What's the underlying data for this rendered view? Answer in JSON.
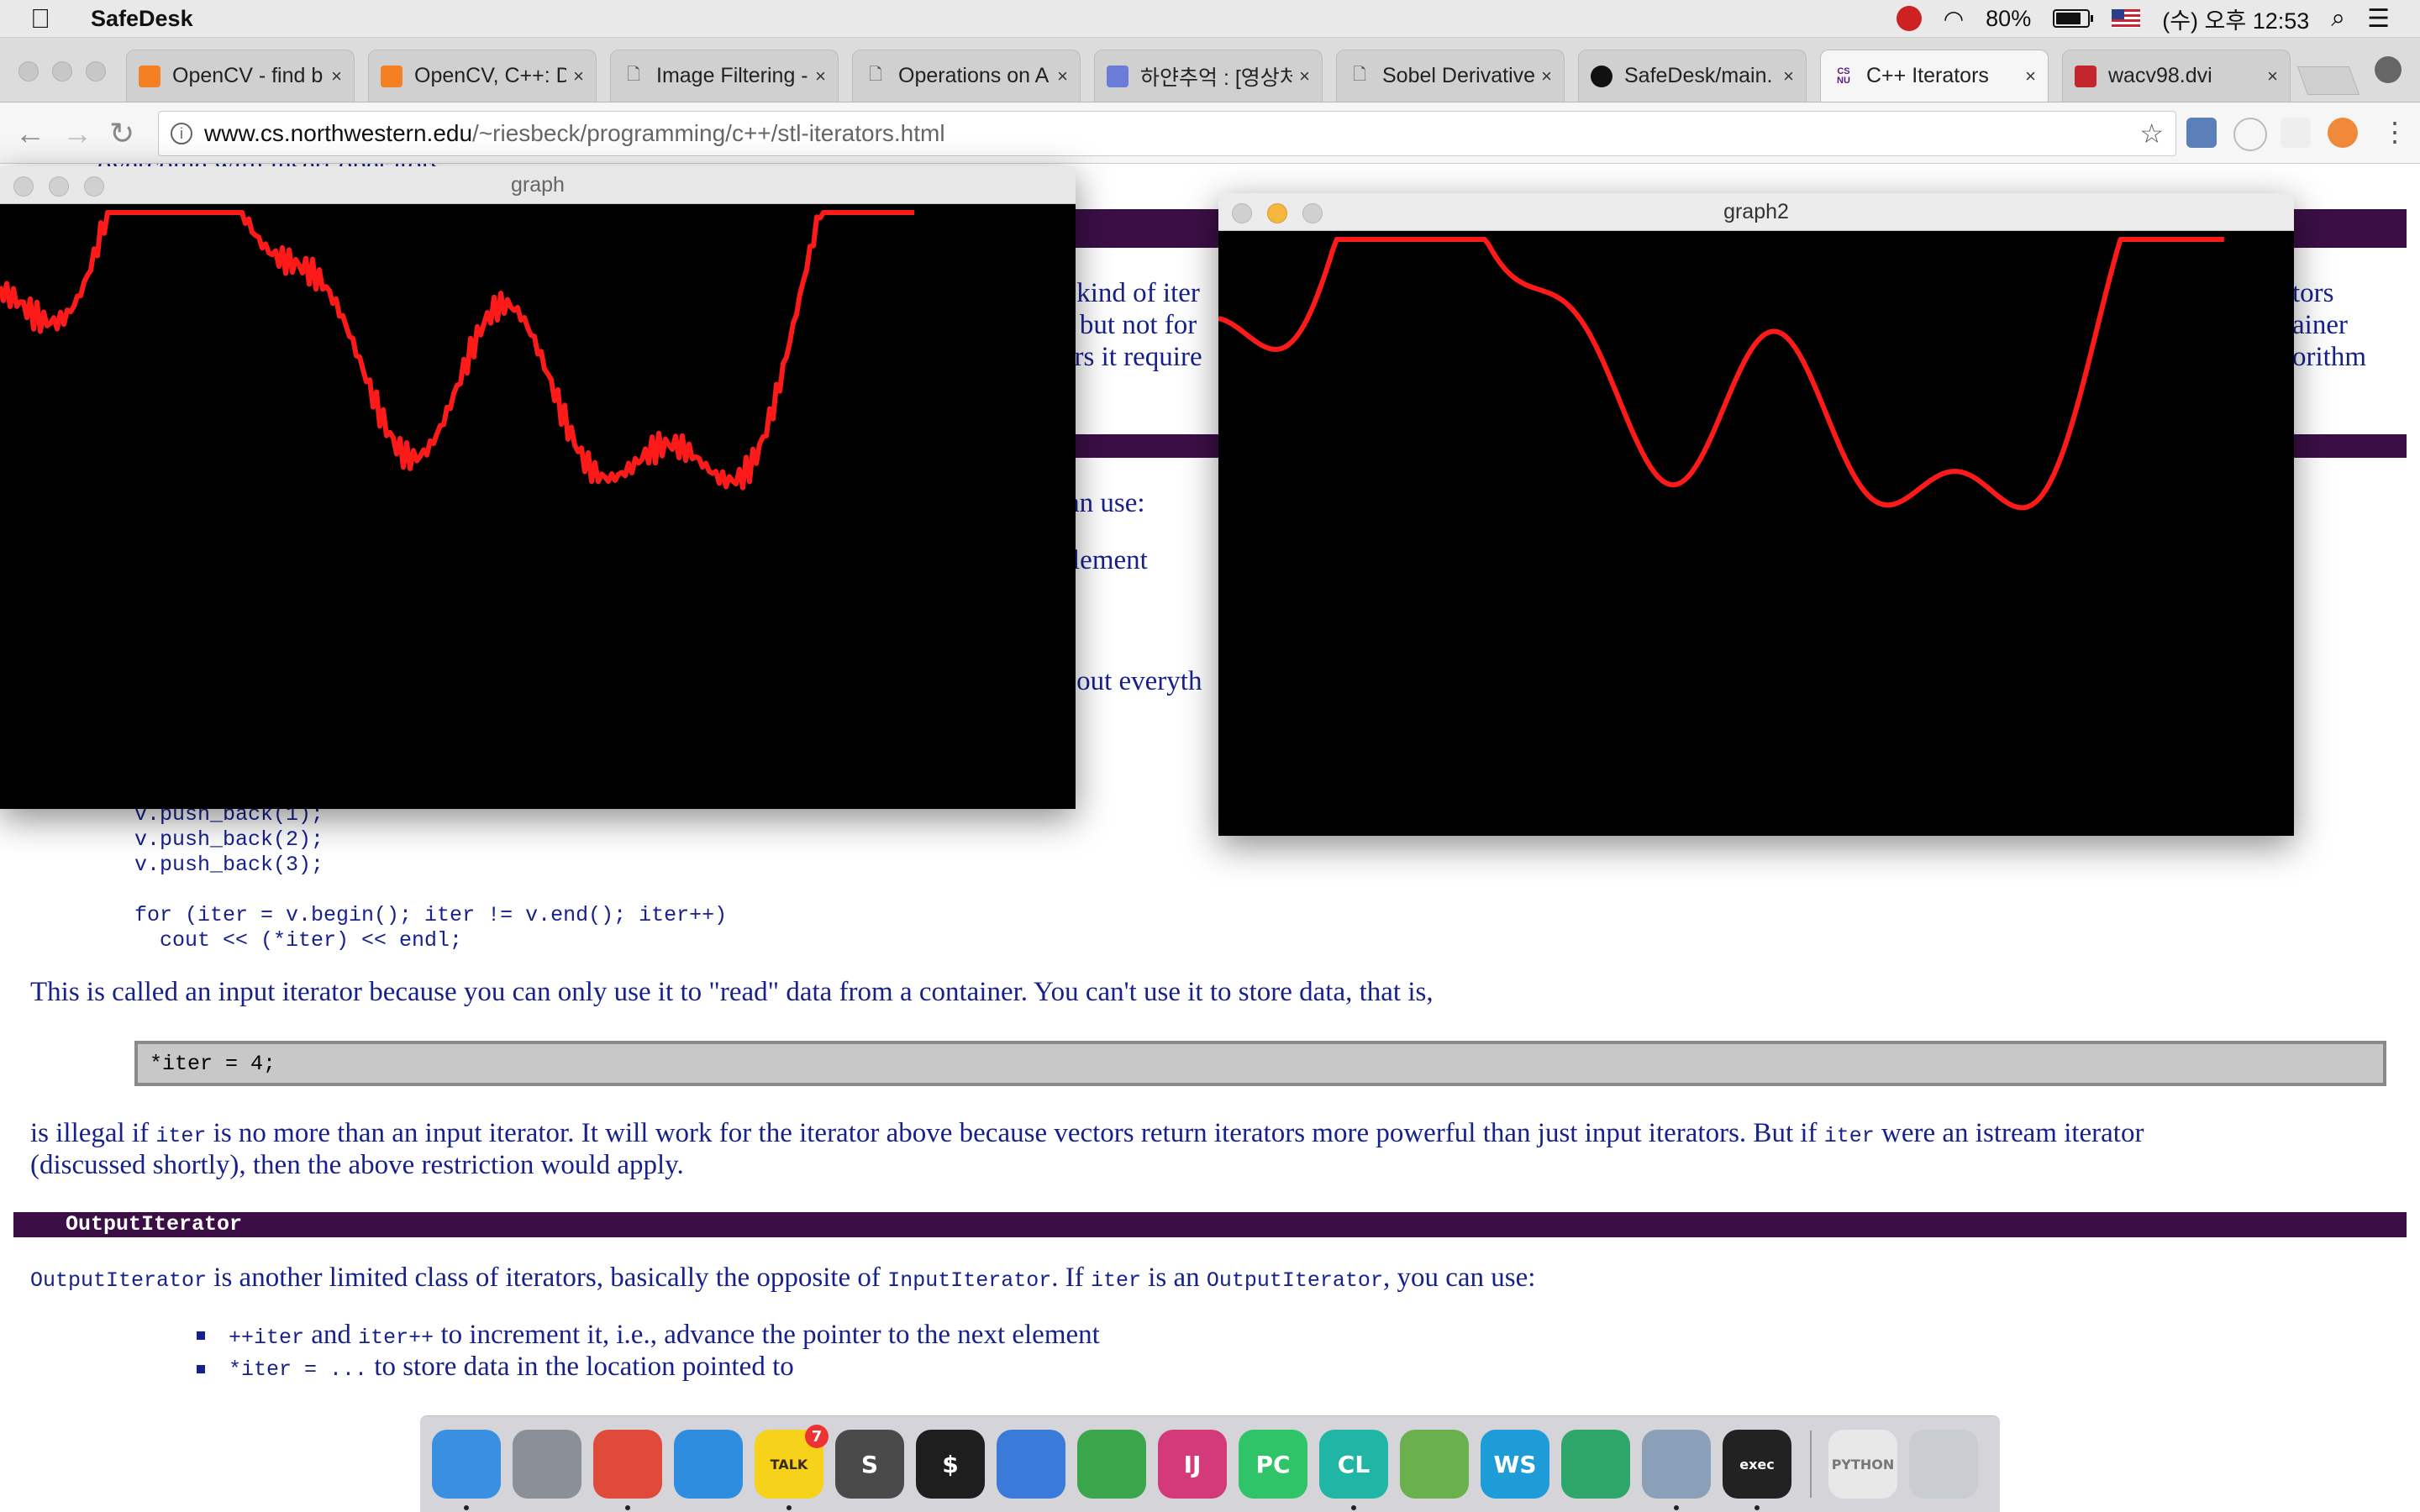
{
  "menubar": {
    "app_name": "SafeDesk",
    "battery": "80%",
    "datetime": "(수) 오후 12:53",
    "battery_level": 0.8
  },
  "tabs": [
    {
      "label": "OpenCV - find b",
      "icon": "stackoverflow-icon",
      "color": "#f48024"
    },
    {
      "label": "OpenCV, C++: D",
      "icon": "stackoverflow-icon",
      "color": "#f48024"
    },
    {
      "label": "Image Filtering -",
      "icon": "document-icon",
      "color": "#555555"
    },
    {
      "label": "Operations on A",
      "icon": "document-icon",
      "color": "#555555"
    },
    {
      "label": "하얀추억 : [영상처",
      "icon": "blog-icon",
      "color": "#6a7bd8"
    },
    {
      "label": "Sobel Derivative",
      "icon": "document-icon",
      "color": "#555555"
    },
    {
      "label": "SafeDesk/main.",
      "icon": "github-icon",
      "color": "#111111"
    },
    {
      "label": "C++ Iterators",
      "icon": "csnu-icon",
      "color": "#5a1a7a",
      "icon_text": "CS NU"
    },
    {
      "label": "wacv98.dvi",
      "icon": "pdf-icon",
      "color": "#c4262e"
    }
  ],
  "address": {
    "host": "www.cs.northwestern.edu",
    "path": "/~riesbeck/programming/c++/stl-iterators.html"
  },
  "windows": {
    "graph": {
      "title": "graph"
    },
    "graph2": {
      "title": "graph2"
    }
  },
  "page": {
    "top_cut_text": "overcome with insert operators",
    "frag_right_1": "f kind of iter",
    "frag_right_2": "a but not for",
    "frag_right_3": "ors it require",
    "frag_far_1": "tors",
    "frag_far_2": "ainer",
    "frag_far_3": "orithm",
    "frag_mid_1": "an use:",
    "frag_mid_2": "lement",
    "frag_mid_3": "s out everyth",
    "code_lines": [
      "v.push_back(1);",
      "v.push_back(2);",
      "v.push_back(3);",
      "",
      "for (iter = v.begin(); iter != v.end(); iter++)",
      "  cout << (*iter) << endl;"
    ],
    "para1": "This is called an input iterator because you can only use it to \"read\" data from a container. You can't use it to store data, that is,",
    "code_box": "*iter = 4;",
    "para2_a": "is illegal if ",
    "para2_code1": "iter",
    "para2_b": " is no more than an input iterator. It will work for the iterator above because vectors return iterators more powerful than just input iterators. But if ",
    "para2_code2": "iter",
    "para2_c": " were an istream iterator",
    "para2_line2": "(discussed shortly), then the above restriction would apply.",
    "section_title": "OutputIterator",
    "para3_code1": "OutputIterator",
    "para3_a": " is another limited class of iterators, basically the opposite of ",
    "para3_code2": "InputIterator",
    "para3_b": ". If ",
    "para3_code3": "iter",
    "para3_c": " is an ",
    "para3_code4": "OutputIterator",
    "para3_d": ", you can use:",
    "bullet1_code1": "++iter",
    "bullet1_a": " and ",
    "bullet1_code2": "iter++",
    "bullet1_b": " to increment it, i.e., advance the pointer to the next element",
    "bullet2_code": "*iter = ...",
    "bullet2_a": " to store data in the location pointed to"
  },
  "dock": [
    {
      "name": "finder",
      "label": "",
      "color": "#3b8fe0",
      "running": true
    },
    {
      "name": "launchpad",
      "label": "",
      "color": "#8a8f98",
      "running": false
    },
    {
      "name": "chrome",
      "label": "",
      "color": "#e04a3a",
      "running": true
    },
    {
      "name": "safari",
      "label": "",
      "color": "#2f8de0",
      "running": false
    },
    {
      "name": "kakaotalk",
      "label": "TALK",
      "color": "#f7d21a",
      "running": true,
      "badge": "7"
    },
    {
      "name": "sublime-text",
      "label": "S",
      "color": "#4a4a4a",
      "running": false
    },
    {
      "name": "terminal",
      "label": "$",
      "color": "#1e1e1e",
      "running": false
    },
    {
      "name": "xcode",
      "label": "",
      "color": "#3a7ad8",
      "running": false
    },
    {
      "name": "evernote",
      "label": "",
      "color": "#3aa54a",
      "running": false
    },
    {
      "name": "intellij",
      "label": "IJ",
      "color": "#d43a7a",
      "running": false
    },
    {
      "name": "pycharm",
      "label": "PC",
      "color": "#2fc468",
      "running": false
    },
    {
      "name": "clion",
      "label": "CL",
      "color": "#21b5a5",
      "running": true
    },
    {
      "name": "android-studio",
      "label": "",
      "color": "#6ab04c",
      "running": false
    },
    {
      "name": "webstorm",
      "label": "WS",
      "color": "#1e9cd7",
      "running": false
    },
    {
      "name": "sourcetree",
      "label": "",
      "color": "#2ea66a",
      "running": false
    },
    {
      "name": "preview",
      "label": "",
      "color": "#8aa0b8",
      "running": true
    },
    {
      "name": "exec-terminal",
      "label": "exec",
      "color": "#222222",
      "running": true
    },
    {
      "name": "python-doc",
      "label": "PYTHON",
      "color": "#e8e8e8",
      "running": false
    },
    {
      "name": "trash",
      "label": "",
      "color": "#c9ccd0",
      "running": false
    }
  ]
}
